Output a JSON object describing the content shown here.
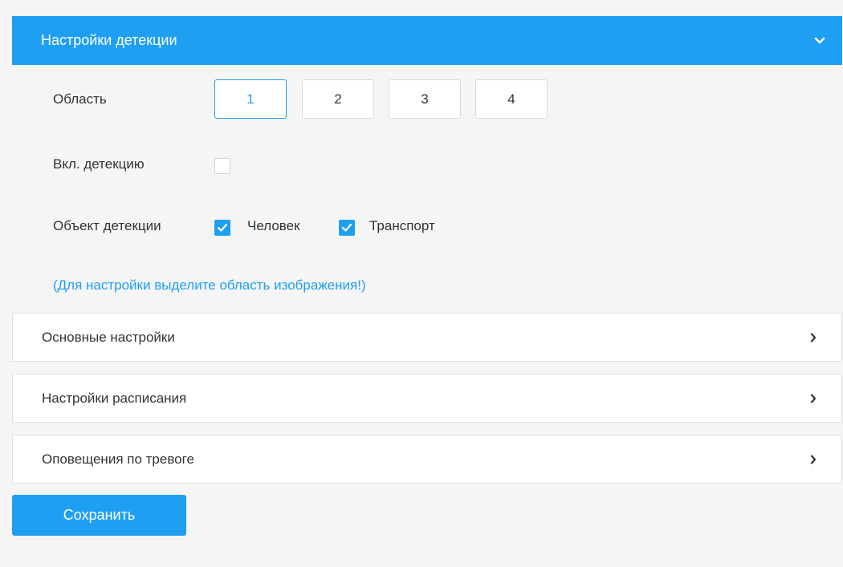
{
  "detection_panel": {
    "title": "Настройки детекции",
    "expand_icon": "chevron-down-icon",
    "area": {
      "label": "Область",
      "buttons": [
        "1",
        "2",
        "3",
        "4"
      ],
      "selected": "1"
    },
    "enable": {
      "label": "Вкл. детекцию",
      "checked": false
    },
    "objects": {
      "label": "Объект детекции",
      "options": [
        {
          "label": "Человек",
          "checked": true
        },
        {
          "label": "Транспорт",
          "checked": true
        }
      ]
    },
    "hint": "(Для настройки выделите область изображения!)"
  },
  "sections": [
    {
      "label": "Основные настройки",
      "icon": "chevron-right-icon"
    },
    {
      "label": "Настройки расписания",
      "icon": "chevron-right-icon"
    },
    {
      "label": "Оповещения по тревоге",
      "icon": "chevron-right-icon"
    }
  ],
  "save_label": "Сохранить",
  "colors": {
    "accent": "#1e9ff2",
    "background": "#f5f5f5",
    "border": "#e0e0e0"
  }
}
